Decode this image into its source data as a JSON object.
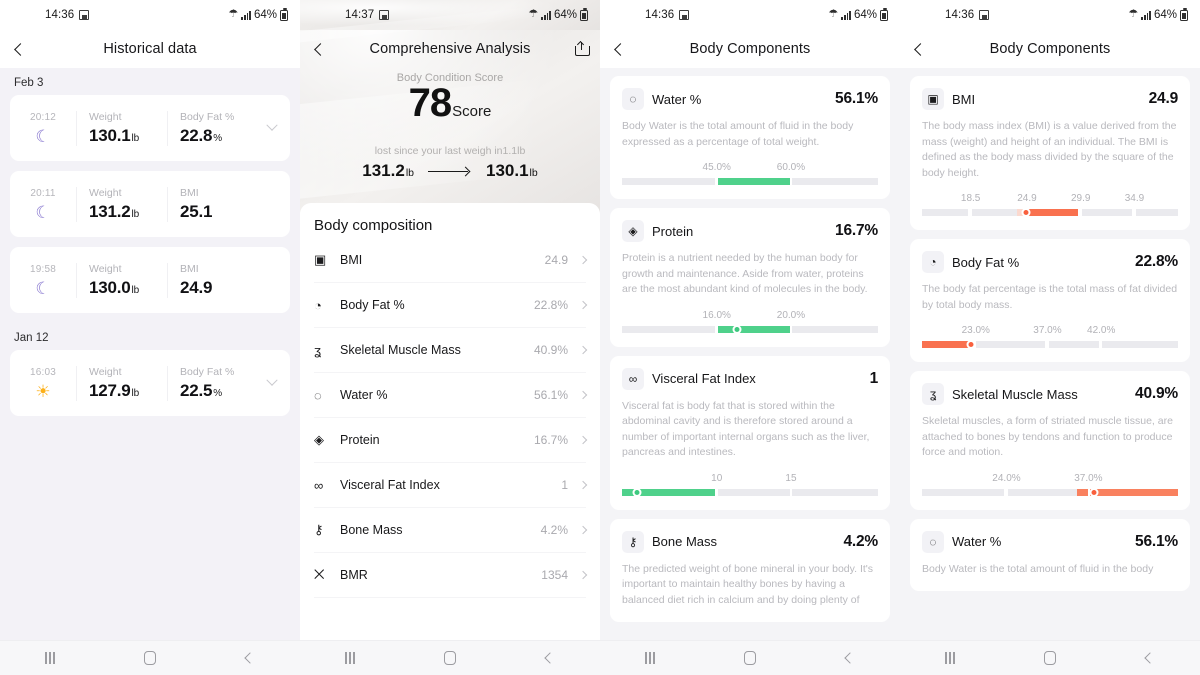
{
  "screens": [
    {
      "id": "historical-data",
      "status": {
        "time": "14:36",
        "battery": "64%",
        "save_icon": "save-icon",
        "wifi_icon": "wifi-icon",
        "signal_icon": "signal-icon",
        "battery_icon": "battery-icon"
      },
      "appbar": {
        "title": "Historical data",
        "back_icon": "back-chevron-icon"
      },
      "groups": [
        {
          "date": "Feb 3",
          "records": [
            {
              "time": "20:12",
              "icon": "moon-icon",
              "icon_glyph": "☾",
              "period": "night",
              "metrics": [
                {
                  "label": "Weight",
                  "value": "130.1",
                  "unit": "lb"
                },
                {
                  "label": "Body Fat %",
                  "value": "22.8",
                  "unit": "%"
                }
              ],
              "expandable": true
            },
            {
              "time": "20:11",
              "icon": "moon-icon",
              "icon_glyph": "☾",
              "period": "night",
              "metrics": [
                {
                  "label": "Weight",
                  "value": "131.2",
                  "unit": "lb"
                },
                {
                  "label": "BMI",
                  "value": "25.1",
                  "unit": ""
                }
              ],
              "expandable": false
            },
            {
              "time": "19:58",
              "icon": "moon-icon",
              "icon_glyph": "☾",
              "period": "night",
              "metrics": [
                {
                  "label": "Weight",
                  "value": "130.0",
                  "unit": "lb"
                },
                {
                  "label": "BMI",
                  "value": "24.9",
                  "unit": ""
                }
              ],
              "expandable": false
            }
          ]
        },
        {
          "date": "Jan 12",
          "records": [
            {
              "time": "16:03",
              "icon": "sun-icon",
              "icon_glyph": "☀",
              "period": "day",
              "metrics": [
                {
                  "label": "Weight",
                  "value": "127.9",
                  "unit": "lb"
                },
                {
                  "label": "Body Fat %",
                  "value": "22.5",
                  "unit": "%"
                }
              ],
              "expandable": true
            }
          ]
        }
      ]
    },
    {
      "id": "comprehensive-analysis",
      "status": {
        "time": "14:37",
        "battery": "64%"
      },
      "appbar": {
        "title": "Comprehensive Analysis",
        "back_icon": "back-chevron-icon",
        "share_icon": "share-icon"
      },
      "score": {
        "label": "Body Condition Score",
        "value": "78",
        "unit": "Score"
      },
      "weigh": {
        "caption": "lost since your last weigh in1.1lb",
        "from": "131.2",
        "from_unit": "lb",
        "to": "130.1",
        "to_unit": "lb",
        "arrow_icon": "arrow-right-icon"
      },
      "composition": {
        "title": "Body composition",
        "rows": [
          {
            "icon": "bmi-icon",
            "icon_glyph": "▣",
            "label": "BMI",
            "value": "24.9"
          },
          {
            "icon": "body-fat-icon",
            "icon_glyph": "◔",
            "label": "Body Fat %",
            "value": "22.8%"
          },
          {
            "icon": "muscle-icon",
            "icon_glyph": "ʓ",
            "label": "Skeletal Muscle Mass",
            "value": "40.9%"
          },
          {
            "icon": "water-drop-icon",
            "icon_glyph": "◌",
            "label": "Water %",
            "value": "56.1%"
          },
          {
            "icon": "protein-icon",
            "icon_glyph": "◈",
            "label": "Protein",
            "value": "16.7%"
          },
          {
            "icon": "visceral-fat-icon",
            "icon_glyph": "∞",
            "label": "Visceral Fat Index",
            "value": "1"
          },
          {
            "icon": "bone-icon",
            "icon_glyph": "⚷",
            "label": "Bone Mass",
            "value": "4.2%"
          },
          {
            "icon": "bmr-icon",
            "icon_glyph": "⨉",
            "label": "BMR",
            "value": "1354"
          }
        ]
      }
    },
    {
      "id": "body-components-water",
      "status": {
        "time": "14:36",
        "battery": "64%"
      },
      "appbar": {
        "title": "Body Components",
        "back_icon": "back-chevron-icon"
      },
      "cards": [
        {
          "icon": "water-drop-icon",
          "icon_glyph": "◌",
          "name": "Water %",
          "value": "56.1%",
          "desc": "Body Water is the total amount of fluid in the body expressed as a percentage of total weight.",
          "ticks": [
            {
              "label": "45.0%",
              "pos": 37
            },
            {
              "label": "60.0%",
              "pos": 66
            }
          ],
          "segments": [
            {
              "start": 0,
              "end": 36.5
            },
            {
              "start": 37.5,
              "end": 65.5
            },
            {
              "start": 66.5,
              "end": 100
            }
          ],
          "fill": {
            "start": 37.5,
            "end": 65.5,
            "color": "#4fd18b"
          },
          "marker": null
        },
        {
          "icon": "protein-icon",
          "icon_glyph": "◈",
          "name": "Protein",
          "value": "16.7%",
          "desc": "Protein is a nutrient needed by the human body for growth and maintenance. Aside from water, proteins are the most abundant kind of molecules in the body.",
          "ticks": [
            {
              "label": "16.0%",
              "pos": 37
            },
            {
              "label": "20.0%",
              "pos": 66
            }
          ],
          "segments": [
            {
              "start": 0,
              "end": 36.5
            },
            {
              "start": 37.5,
              "end": 65.5
            },
            {
              "start": 66.5,
              "end": 100
            }
          ],
          "fill": {
            "start": 37.5,
            "end": 65.5,
            "color": "#4fd18b"
          },
          "marker": {
            "pos": 45,
            "color": "#3ec97f"
          }
        },
        {
          "icon": "visceral-fat-icon",
          "icon_glyph": "∞",
          "name": "Visceral Fat Index",
          "value": "1",
          "desc": "Visceral fat is body fat that is stored within the abdominal cavity and is therefore stored around a number of important internal organs such as the liver, pancreas and intestines.",
          "ticks": [
            {
              "label": "10",
              "pos": 37
            },
            {
              "label": "15",
              "pos": 66
            }
          ],
          "segments": [
            {
              "start": 0,
              "end": 36.5
            },
            {
              "start": 37.5,
              "end": 65.5
            },
            {
              "start": 66.5,
              "end": 100
            }
          ],
          "fill": {
            "start": 0,
            "end": 36.5,
            "color": "#4fd18b"
          },
          "marker": {
            "pos": 6,
            "color": "#3ec97f"
          }
        },
        {
          "icon": "bone-icon",
          "icon_glyph": "⚷",
          "name": "Bone Mass",
          "value": "4.2%",
          "desc": "The predicted weight of bone mineral in your body. It's important to maintain healthy bones by having a balanced diet rich in calcium and by doing plenty of",
          "ticks": [],
          "segments": [],
          "fill": null,
          "marker": null
        }
      ]
    },
    {
      "id": "body-components-bmi",
      "status": {
        "time": "14:36",
        "battery": "64%"
      },
      "appbar": {
        "title": "Body Components",
        "back_icon": "back-chevron-icon"
      },
      "cards": [
        {
          "icon": "bmi-icon",
          "icon_glyph": "▣",
          "name": "BMI",
          "value": "24.9",
          "desc": "The body mass index (BMI) is a value derived from the mass (weight) and height of an individual. The BMI is defined as the body mass divided by the square of the body height.",
          "ticks": [
            {
              "label": "18.5",
              "pos": 19
            },
            {
              "label": "24.9",
              "pos": 41
            },
            {
              "label": "29.9",
              "pos": 62
            },
            {
              "label": "34.9",
              "pos": 83
            }
          ],
          "segments": [
            {
              "start": 0,
              "end": 18
            },
            {
              "start": 19.5,
              "end": 40
            },
            {
              "start": 41.5,
              "end": 61
            },
            {
              "start": 62.5,
              "end": 82
            },
            {
              "start": 83.5,
              "end": 100
            }
          ],
          "fill": {
            "start": 41.5,
            "end": 61,
            "color": "#f9714f"
          },
          "prefill": {
            "start": 37,
            "end": 41.5,
            "color": "#fbd9cf"
          },
          "marker": {
            "pos": 40.5,
            "color": "#f9603d"
          }
        },
        {
          "icon": "body-fat-icon",
          "icon_glyph": "◔",
          "name": "Body Fat %",
          "value": "22.8%",
          "desc": "The body fat percentage is the total mass of fat divided by total body mass.",
          "ticks": [
            {
              "label": "23.0%",
              "pos": 21
            },
            {
              "label": "37.0%",
              "pos": 49
            },
            {
              "label": "42.0%",
              "pos": 70
            }
          ],
          "segments": [
            {
              "start": 0,
              "end": 19.5
            },
            {
              "start": 21,
              "end": 48
            },
            {
              "start": 49.5,
              "end": 69
            },
            {
              "start": 70.5,
              "end": 100
            }
          ],
          "fill": {
            "start": 0,
            "end": 19.5,
            "color": "#f9714f"
          },
          "marker": {
            "pos": 19,
            "color": "#f9603d"
          }
        },
        {
          "icon": "muscle-icon",
          "icon_glyph": "ʓ",
          "name": "Skeletal Muscle Mass",
          "value": "40.9%",
          "desc": "Skeletal muscles, a form of striated muscle tissue, are attached to bones by tendons and function to produce force and motion.",
          "ticks": [
            {
              "label": "24.0%",
              "pos": 33
            },
            {
              "label": "37.0%",
              "pos": 65
            }
          ],
          "segments": [
            {
              "start": 0,
              "end": 32
            },
            {
              "start": 33.5,
              "end": 64
            },
            {
              "start": 65.5,
              "end": 100
            }
          ],
          "fill": {
            "start": 65.5,
            "end": 100,
            "color": "#f9815f"
          },
          "prefill": {
            "start": 60.5,
            "end": 65,
            "color": "#f9815f"
          },
          "marker": {
            "pos": 67,
            "color": "#f9603d"
          }
        },
        {
          "icon": "water-drop-icon",
          "icon_glyph": "◌",
          "name": "Water %",
          "value": "56.1%",
          "desc": "Body Water is the total amount of fluid in the body",
          "ticks": [],
          "segments": [],
          "fill": null,
          "marker": null
        }
      ]
    }
  ],
  "navbar": {
    "recents": "recents-icon",
    "home": "home-icon",
    "back": "back-icon"
  }
}
